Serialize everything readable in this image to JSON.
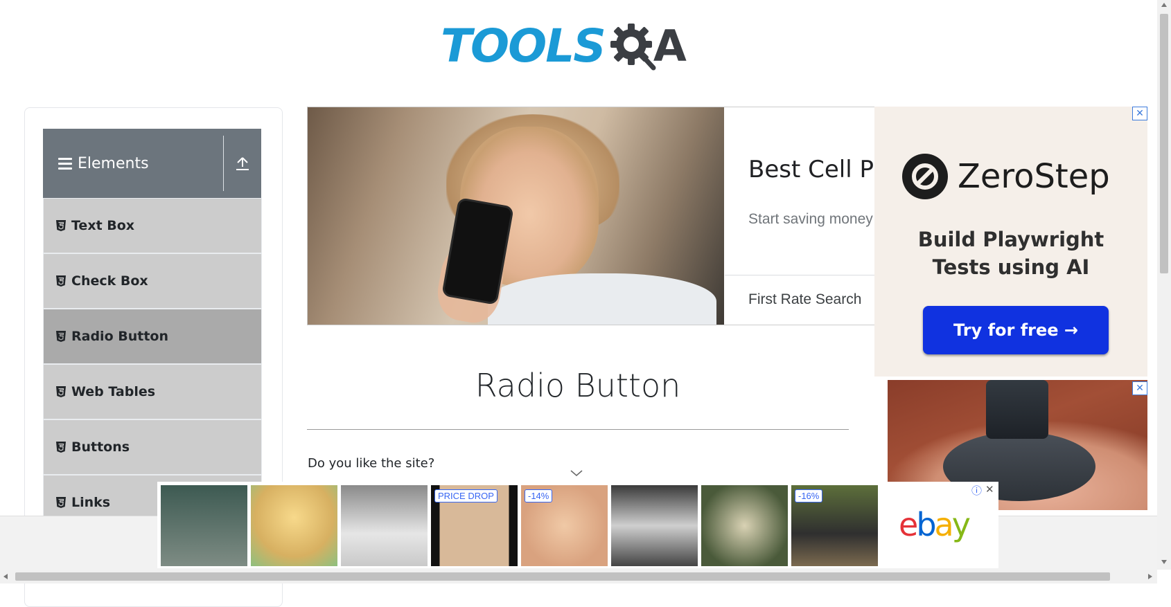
{
  "logo": {
    "text_primary": "TOOLS",
    "text_secondary": "A"
  },
  "sidebar": {
    "group_title": "Elements",
    "items": [
      {
        "label": "Text Box",
        "active": false
      },
      {
        "label": "Check Box",
        "active": false
      },
      {
        "label": "Radio Button",
        "active": true
      },
      {
        "label": "Web Tables",
        "active": false
      },
      {
        "label": "Buttons",
        "active": false
      },
      {
        "label": "Links",
        "active": false
      }
    ]
  },
  "ad_top": {
    "headline": "Best Cell P",
    "subtext": "Start saving money",
    "brand": "First Rate Search"
  },
  "main": {
    "title": "Radio Button",
    "question": "Do you like the site?"
  },
  "ad_right": {
    "brand": "ZeroStep",
    "tagline_line1": "Build Playwright",
    "tagline_line2": "Tests using AI",
    "cta": "Try for free →",
    "close": "✕"
  },
  "ebay_banner": {
    "badges": [
      "PRICE DROP",
      "-14%",
      "-16%"
    ],
    "logo": [
      "e",
      "b",
      "a",
      "y"
    ],
    "info": "ⓘ",
    "close": "✕"
  },
  "colors": {
    "brand_blue": "#1b9ad6",
    "sidebar_header": "#6c757d",
    "menu_item": "#cccccc",
    "menu_item_active": "#aaaaaa",
    "cta_blue": "#1032e0"
  }
}
